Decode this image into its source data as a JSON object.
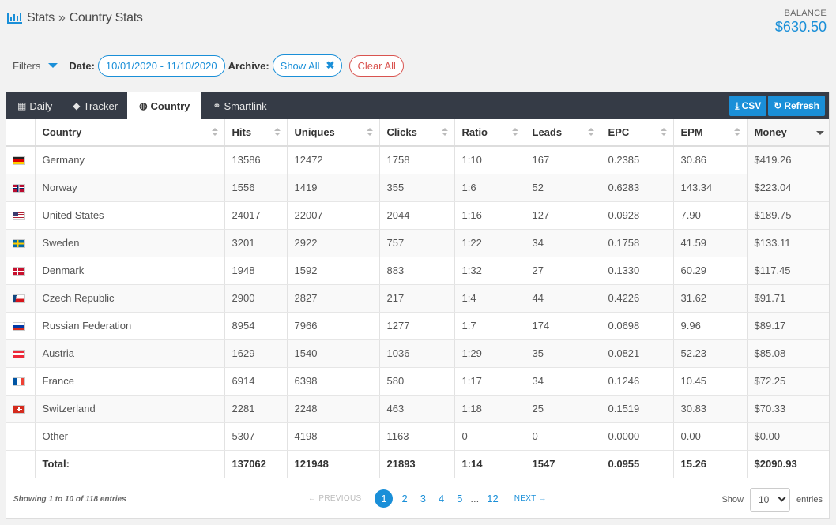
{
  "breadcrumb": {
    "section": "Stats",
    "separator": "»",
    "page": "Country Stats"
  },
  "balance": {
    "label": "BALANCE",
    "value": "$630.50"
  },
  "filters": {
    "title": "Filters",
    "date_label": "Date:",
    "date_value": "10/01/2020 - 11/10/2020",
    "archive_label": "Archive:",
    "archive_value": "Show All",
    "clear_label": "Clear All"
  },
  "tabs": [
    {
      "label": "Daily",
      "icon": "calendar-icon"
    },
    {
      "label": "Tracker",
      "icon": "tag-icon"
    },
    {
      "label": "Country",
      "icon": "globe-icon",
      "active": true
    },
    {
      "label": "Smartlink",
      "icon": "link-icon"
    }
  ],
  "buttons": {
    "csv": "CSV",
    "refresh": "Refresh"
  },
  "columns": [
    "Country",
    "Hits",
    "Uniques",
    "Clicks",
    "Ratio",
    "Leads",
    "EPC",
    "EPM",
    "Money"
  ],
  "rows": [
    {
      "flag": "de",
      "country": "Germany",
      "hits": "13586",
      "uniques": "12472",
      "clicks": "1758",
      "ratio": "1:10",
      "leads": "167",
      "epc": "0.2385",
      "epm": "30.86",
      "money": "$419.26"
    },
    {
      "flag": "no",
      "country": "Norway",
      "hits": "1556",
      "uniques": "1419",
      "clicks": "355",
      "ratio": "1:6",
      "leads": "52",
      "epc": "0.6283",
      "epm": "143.34",
      "money": "$223.04"
    },
    {
      "flag": "us",
      "country": "United States",
      "hits": "24017",
      "uniques": "22007",
      "clicks": "2044",
      "ratio": "1:16",
      "leads": "127",
      "epc": "0.0928",
      "epm": "7.90",
      "money": "$189.75"
    },
    {
      "flag": "se",
      "country": "Sweden",
      "hits": "3201",
      "uniques": "2922",
      "clicks": "757",
      "ratio": "1:22",
      "leads": "34",
      "epc": "0.1758",
      "epm": "41.59",
      "money": "$133.11"
    },
    {
      "flag": "dk",
      "country": "Denmark",
      "hits": "1948",
      "uniques": "1592",
      "clicks": "883",
      "ratio": "1:32",
      "leads": "27",
      "epc": "0.1330",
      "epm": "60.29",
      "money": "$117.45"
    },
    {
      "flag": "cz",
      "country": "Czech Republic",
      "hits": "2900",
      "uniques": "2827",
      "clicks": "217",
      "ratio": "1:4",
      "leads": "44",
      "epc": "0.4226",
      "epm": "31.62",
      "money": "$91.71"
    },
    {
      "flag": "ru",
      "country": "Russian Federation",
      "hits": "8954",
      "uniques": "7966",
      "clicks": "1277",
      "ratio": "1:7",
      "leads": "174",
      "epc": "0.0698",
      "epm": "9.96",
      "money": "$89.17"
    },
    {
      "flag": "at",
      "country": "Austria",
      "hits": "1629",
      "uniques": "1540",
      "clicks": "1036",
      "ratio": "1:29",
      "leads": "35",
      "epc": "0.0821",
      "epm": "52.23",
      "money": "$85.08"
    },
    {
      "flag": "fr",
      "country": "France",
      "hits": "6914",
      "uniques": "6398",
      "clicks": "580",
      "ratio": "1:17",
      "leads": "34",
      "epc": "0.1246",
      "epm": "10.45",
      "money": "$72.25"
    },
    {
      "flag": "ch",
      "country": "Switzerland",
      "hits": "2281",
      "uniques": "2248",
      "clicks": "463",
      "ratio": "1:18",
      "leads": "25",
      "epc": "0.1519",
      "epm": "30.83",
      "money": "$70.33"
    },
    {
      "flag": "",
      "country": "Other",
      "hits": "5307",
      "uniques": "4198",
      "clicks": "1163",
      "ratio": "0",
      "leads": "0",
      "epc": "0.0000",
      "epm": "0.00",
      "money": "$0.00"
    }
  ],
  "total": {
    "label": "Total:",
    "hits": "137062",
    "uniques": "121948",
    "clicks": "21893",
    "ratio": "1:14",
    "leads": "1547",
    "epc": "0.0955",
    "epm": "15.26",
    "money": "$2090.93"
  },
  "footer": {
    "info": "Showing 1 to 10 of 118 entries",
    "previous": "← PREVIOUS",
    "next": "NEXT →",
    "pages": [
      "1",
      "2",
      "3",
      "4",
      "5"
    ],
    "ellipsis": "...",
    "last_page": "12",
    "current_page": "1",
    "show_label": "Show",
    "page_size": "10",
    "entries_label": "entries"
  },
  "colors": {
    "accent": "#1a8fd8",
    "danger": "#d9534f",
    "tabbar": "#353b46"
  }
}
